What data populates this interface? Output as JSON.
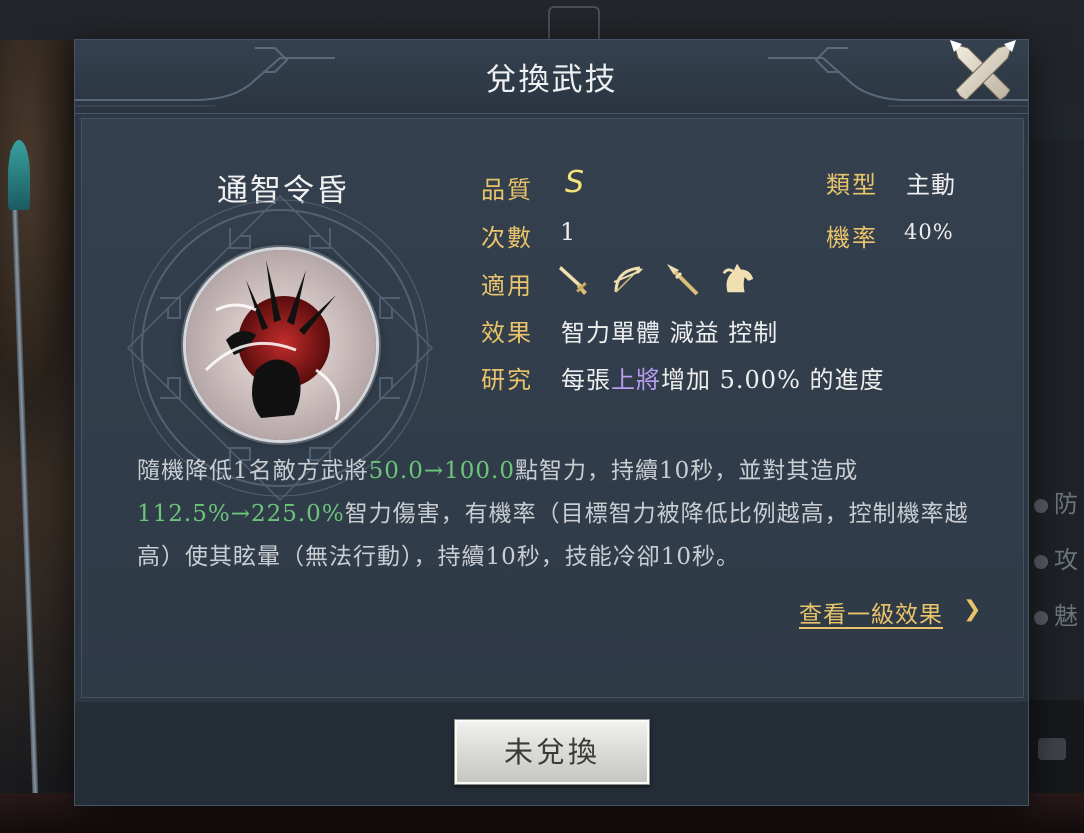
{
  "modal": {
    "title": "兌換武技",
    "close_icon": "crossed-swords-close-icon"
  },
  "skill": {
    "name": "通智令昏",
    "icon": "skill-emblem-icon"
  },
  "attributes": {
    "quality_label": "品質",
    "quality_value": "S",
    "type_label": "類型",
    "type_value": "主動",
    "count_label": "次數",
    "count_value": "1",
    "rate_label": "機率",
    "rate_value": "40%",
    "applicable_label": "適用",
    "applicable_icons": [
      "sword-icon",
      "bow-icon",
      "spear-icon",
      "horse-icon"
    ],
    "effect_label": "效果",
    "effect_value": "智力單體 減益 控制",
    "research_label": "研究",
    "research_prefix": "每張",
    "research_highlight": "上將",
    "research_suffix": "增加 5.00% 的進度"
  },
  "description": {
    "p1": "隨機降低1名敵方武將",
    "v1": "50.0→100.0",
    "p2": "點智力，持續10秒，並對其造成",
    "v2": "112.5%→225.0%",
    "p3": "智力傷害，有機率（目標智力被降低比例越高，控制機率越高）使其眩暈（無法行動），持續10秒，技能冷卻10秒。"
  },
  "links": {
    "view_level1": "查看一級效果",
    "chevron": "❯"
  },
  "footer": {
    "exchange_button": "未兌換"
  },
  "background": {
    "right_items": [
      "防",
      "攻",
      "魅"
    ]
  },
  "colors": {
    "label_gold": "#e9c46a",
    "value_green": "#6cc47a",
    "highlight_purple": "#b79cf0",
    "modal_bg": "#2d3744"
  }
}
